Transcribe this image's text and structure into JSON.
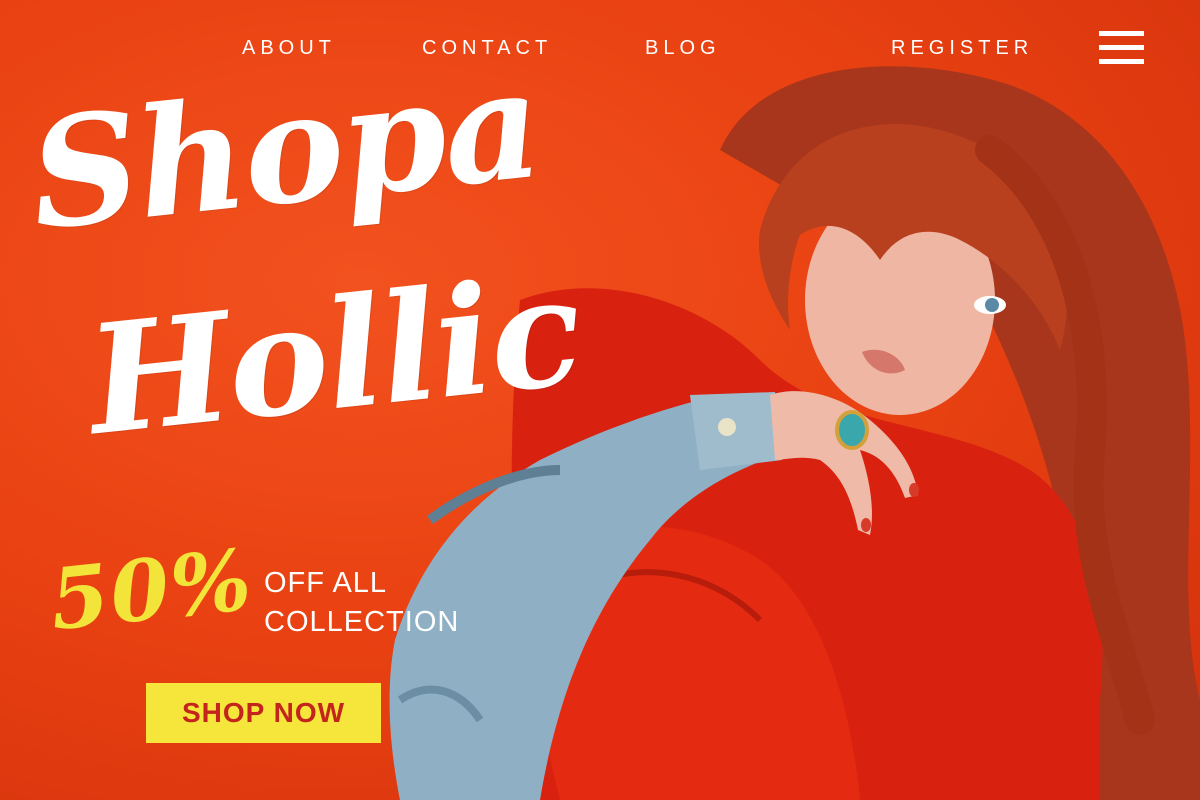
{
  "nav": {
    "items": [
      {
        "label": "ABOUT"
      },
      {
        "label": "CONTACT"
      },
      {
        "label": "BLOG"
      },
      {
        "label": "REGISTER"
      }
    ],
    "menu_icon": "hamburger-menu-icon"
  },
  "hero": {
    "headline_line1": "Shopa",
    "headline_line2": "Hollic",
    "offer_percent": "50%",
    "offer_text_line1": "OFF ALL",
    "offer_text_line2": "COLLECTION",
    "cta_label": "SHOP NOW"
  },
  "colors": {
    "background": "#ea4212",
    "accent_yellow": "#f6e63c",
    "cta_text": "#c3241b",
    "text": "#ffffff"
  }
}
